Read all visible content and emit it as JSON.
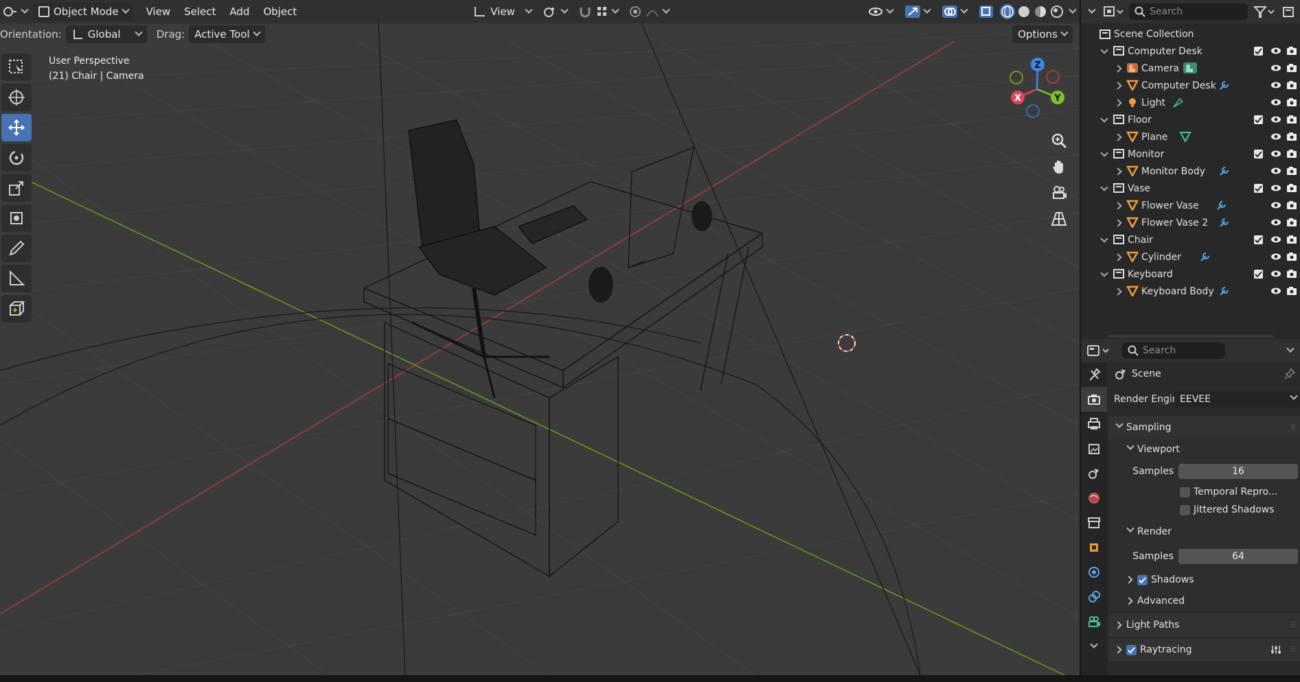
{
  "header": {
    "mode": "Object Mode",
    "menus": [
      "View",
      "Select",
      "Add",
      "Object"
    ],
    "transform_view": "View"
  },
  "toolbar2": {
    "orientation_label": "Orientation:",
    "orientation_value": "Global",
    "drag_label": "Drag:",
    "drag_value": "Active Tool",
    "options": "Options"
  },
  "viewport": {
    "perspective": "User Perspective",
    "context": "(21) Chair | Camera"
  },
  "gizmo": {
    "x": "X",
    "y": "Y",
    "z": "Z"
  },
  "outliner": {
    "search_placeholder": "Search",
    "root": "Scene Collection",
    "rows": [
      {
        "name": "Computer Desk",
        "level": 1,
        "type": "collection",
        "open": true
      },
      {
        "name": "Camera",
        "level": 2,
        "type": "camera"
      },
      {
        "name": "Computer Desk",
        "level": 2,
        "type": "mesh"
      },
      {
        "name": "Light",
        "level": 2,
        "type": "light"
      },
      {
        "name": "Floor",
        "level": 1,
        "type": "collection",
        "open": true
      },
      {
        "name": "Plane",
        "level": 2,
        "type": "mesh"
      },
      {
        "name": "Monitor",
        "level": 1,
        "type": "collection",
        "open": true
      },
      {
        "name": "Monitor Body",
        "level": 2,
        "type": "mesh"
      },
      {
        "name": "Vase",
        "level": 1,
        "type": "collection",
        "open": true
      },
      {
        "name": "Flower Vase",
        "level": 2,
        "type": "mesh"
      },
      {
        "name": "Flower Vase 2",
        "level": 2,
        "type": "mesh"
      },
      {
        "name": "Chair",
        "level": 1,
        "type": "collection",
        "open": true
      },
      {
        "name": "Cylinder",
        "level": 2,
        "type": "mesh"
      },
      {
        "name": "Keyboard",
        "level": 1,
        "type": "collection",
        "open": true
      },
      {
        "name": "Keyboard Body",
        "level": 2,
        "type": "mesh"
      }
    ]
  },
  "properties": {
    "search_placeholder": "Search",
    "context": "Scene",
    "render_engine_label": "Render Engine",
    "render_engine_value": "EEVEE",
    "sampling": "Sampling",
    "viewport_section": "Viewport",
    "samples_label": "Samples",
    "viewport_samples": "16",
    "temporal": "Temporal Repro...",
    "jittered": "Jittered Shadows",
    "render_section": "Render",
    "render_samples": "64",
    "shadows": "Shadows",
    "advanced": "Advanced",
    "light_paths": "Light Paths",
    "raytracing": "Raytracing"
  },
  "colors": {
    "accent": "#4772b3",
    "axis_x": "#e0445a",
    "axis_y": "#7fbf2a",
    "axis_z": "#3d86e6",
    "mesh_icon": "#f09a3a"
  }
}
